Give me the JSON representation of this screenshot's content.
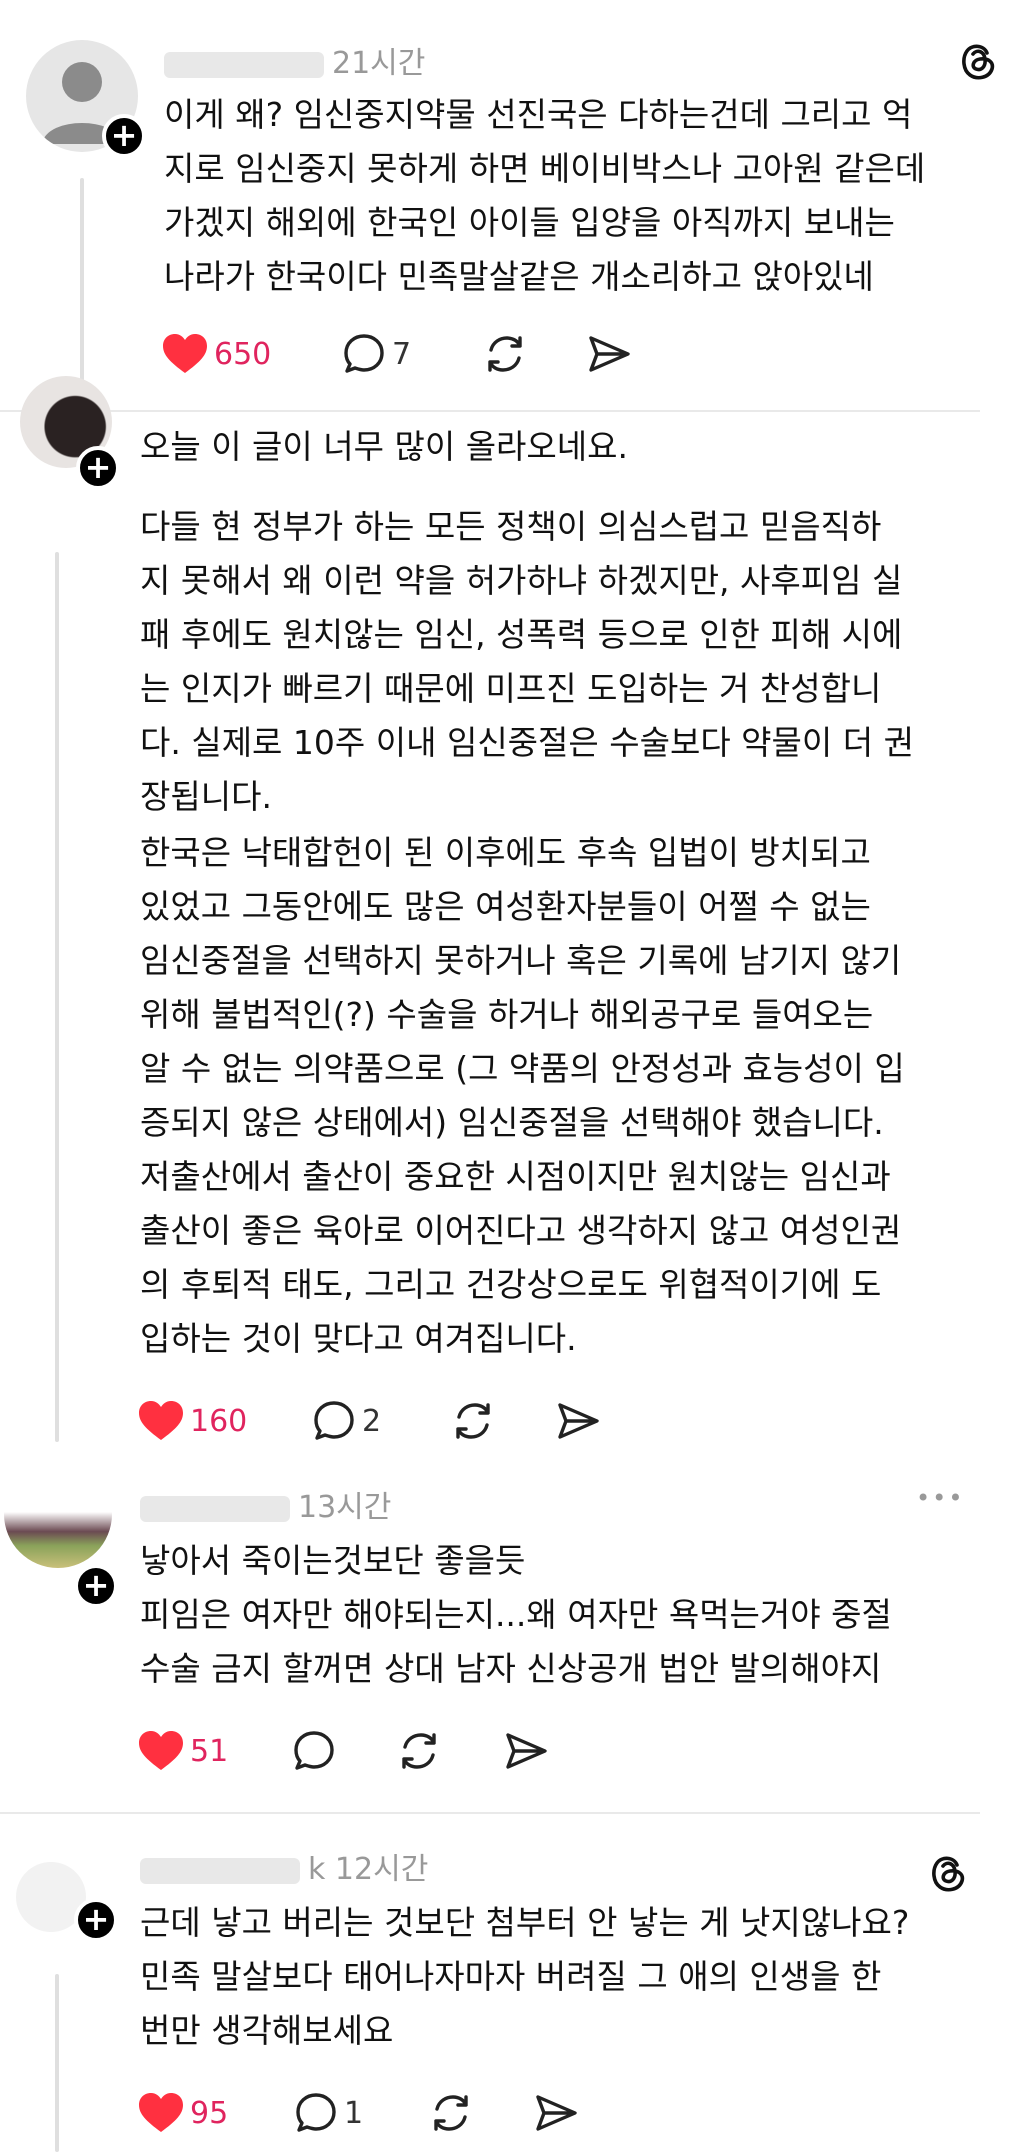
{
  "accent_color": "#ff3040",
  "posts": [
    {
      "time": "21시간",
      "lines": [
        "이게 왜? 임신중지약물 선진국은 다하는건데 그리고 억",
        "지로 임신중지 못하게 하면 베이비박스나 고아원 같은데",
        "가겠지 해외에 한국인 아이들 입양을 아직까지 보내는",
        "나라가 한국이다 민족말살같은 개소리하고 앉아있네"
      ],
      "likes": "650",
      "comments": "7",
      "icons": [
        "avatar-placeholder-icon",
        "threads-logo-icon",
        "heart-icon",
        "comment-icon",
        "repost-icon",
        "share-icon"
      ]
    },
    {
      "paragraph1": [
        "오늘 이 글이 너무 많이 올라오네요."
      ],
      "paragraph2": [
        "다들 현 정부가 하는 모든 정책이 의심스럽고 믿음직하",
        "지 못해서 왜 이런 약을 허가하냐 하겠지만, 사후피임 실",
        "패 후에도 원치않는 임신, 성폭력 등으로 인한 피해 시에",
        "는 인지가 빠르기 때문에 미프진 도입하는 거 찬성합니",
        "다. 실제로 10주 이내 임신중절은 수술보다 약물이 더 권",
        "장됩니다."
      ],
      "paragraph3": [
        "한국은 낙태합헌이 된 이후에도 후속 입법이 방치되고",
        "있었고 그동안에도 많은 여성환자분들이 어쩔 수 없는",
        "임신중절을 선택하지 못하거나 혹은 기록에 남기지 않기",
        "위해 불법적인(?) 수술을 하거나 해외공구로 들여오는",
        "알 수 없는 의약품으로 (그 약품의 안정성과 효능성이 입",
        "증되지 않은 상태에서) 임신중절을 선택해야 했습니다.",
        "저출산에서 출산이 중요한 시점이지만 원치않는 임신과",
        "출산이 좋은 육아로 이어진다고 생각하지 않고 여성인권",
        "의 후퇴적 태도, 그리고 건강상으로도 위협적이기에 도",
        "입하는 것이 맞다고 여겨집니다."
      ],
      "likes": "160",
      "comments": "2"
    },
    {
      "time": "13시간",
      "more": "•••",
      "lines": [
        "낳아서 죽이는것보단 좋을듯",
        "피임은 여자만 해야되는지...왜 여자만 욕먹는거야 중절",
        "수술 금지 할꺼면 상대 남자 신상공개 법안 발의해야지"
      ],
      "likes": "51"
    },
    {
      "time_prefix": "k",
      "time": "12시간",
      "lines": [
        "근데 낳고 버리는 것보단 첨부터 안 낳는 게 낫지않나요?",
        "민족 말살보다 태어나자마자 버려질 그 애의 인생을 한",
        "번만 생각해보세요"
      ],
      "likes": "95",
      "comments": "1"
    }
  ]
}
